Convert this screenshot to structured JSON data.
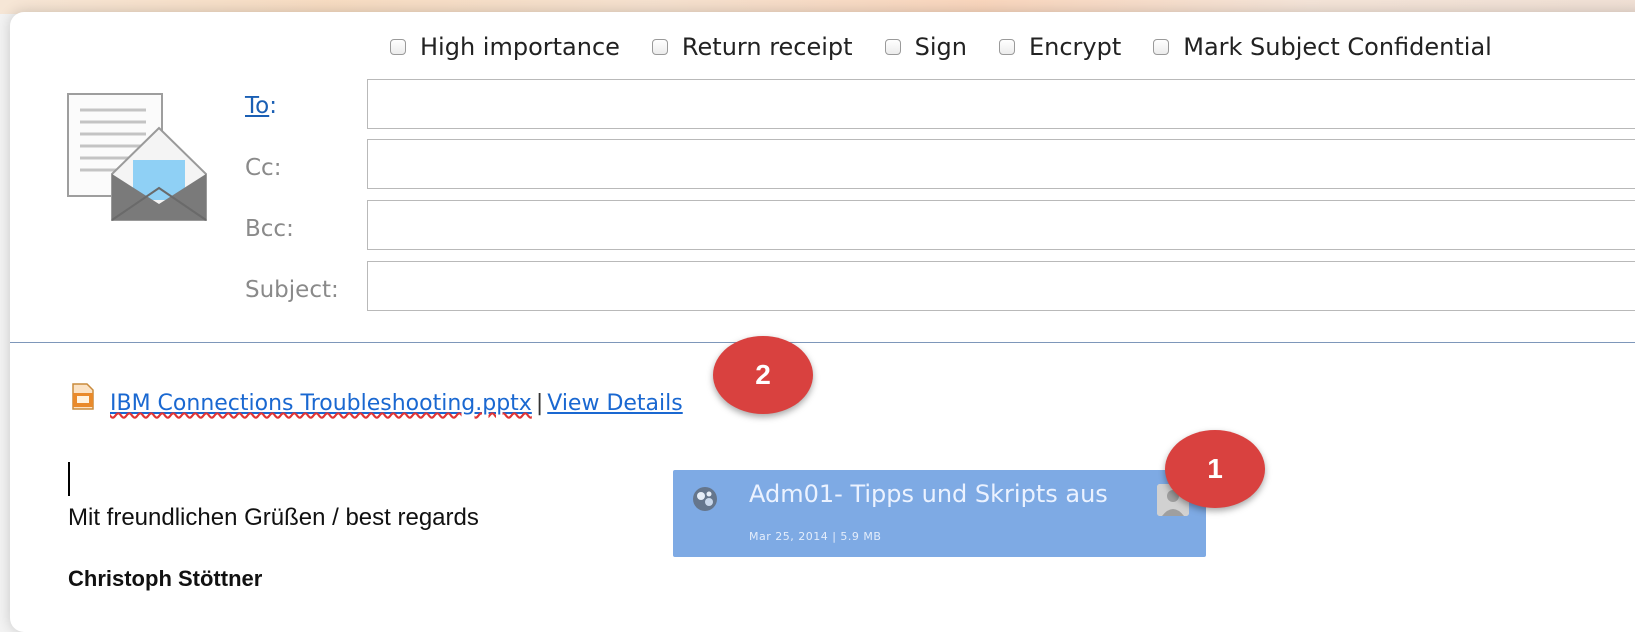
{
  "options": [
    {
      "label": "High importance",
      "checked": false
    },
    {
      "label": "Return receipt",
      "checked": false
    },
    {
      "label": "Sign",
      "checked": false
    },
    {
      "label": "Encrypt",
      "checked": false
    },
    {
      "label": "Mark Subject Confidential",
      "checked": false
    }
  ],
  "fields": {
    "to_label_link": "To",
    "to_label_colon": ":",
    "cc_label": "Cc:",
    "bcc_label": "Bcc:",
    "subject_label": "Subject:",
    "to_value": "",
    "cc_value": "",
    "bcc_value": "",
    "subject_value": ""
  },
  "attachment": {
    "file_name": "IBM Connections Troubleshooting.pptx",
    "separator": "|",
    "details_link": "View Details",
    "icon": "pptx-file-icon"
  },
  "body": {
    "regards": "Mit freundlichen Grüßen / best regards",
    "signature_name": "Christoph Stöttner"
  },
  "drag_card": {
    "title": "Adm01- Tipps und Skripts aus",
    "meta": "Mar 25, 2014 | 5.9 MB",
    "icon": "file-type-icon",
    "avatar": "user-avatar-icon"
  },
  "badges": {
    "one": "1",
    "two": "2",
    "color": "#d9413f"
  },
  "colors": {
    "link": "#1a68d1",
    "drag_card": "#78a6e3",
    "divider": "#7e97ba"
  }
}
